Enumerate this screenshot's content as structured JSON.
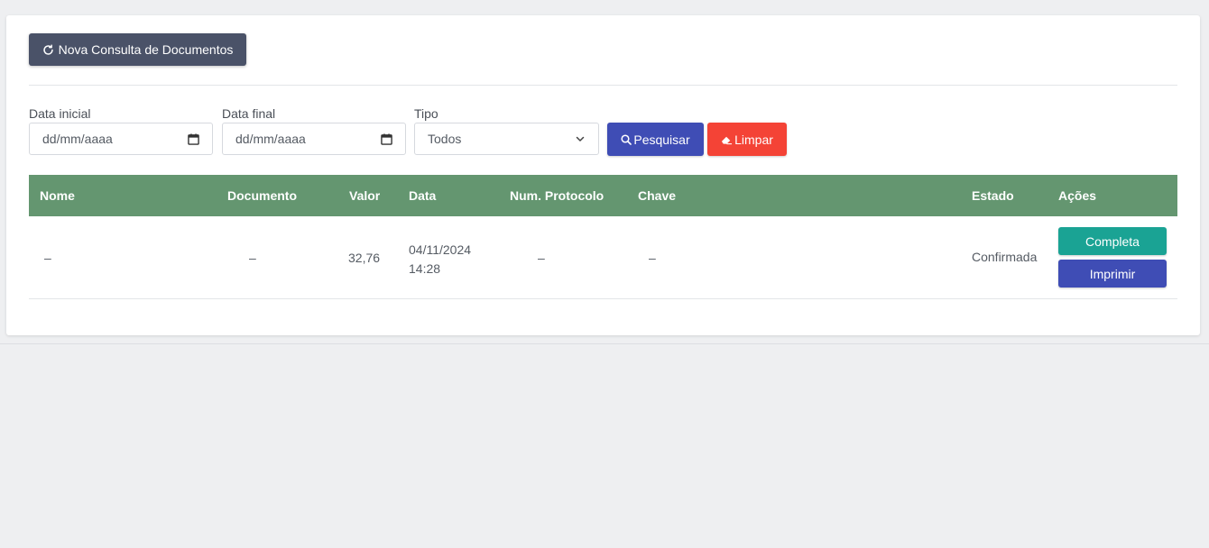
{
  "toolbar": {
    "new_query_label": "Nova Consulta de Documentos",
    "new_query_icon": "refresh-icon"
  },
  "filters": {
    "start_date": {
      "label": "Data inicial",
      "placeholder": "dd/mm/aaaa",
      "icon": "calendar-icon"
    },
    "end_date": {
      "label": "Data final",
      "placeholder": "dd/mm/aaaa",
      "icon": "calendar-icon"
    },
    "type": {
      "label": "Tipo",
      "selected": "Todos",
      "icon": "chevron-down-icon"
    },
    "search_label": "Pesquisar",
    "search_icon": "search-icon",
    "clear_label": "Limpar",
    "clear_icon": "eraser-icon"
  },
  "table": {
    "columns": [
      "Nome",
      "Documento",
      "Valor",
      "Data",
      "Num. Protocolo",
      "Chave",
      "Estado",
      "Ações"
    ],
    "rows": [
      {
        "nome": "–",
        "documento": "–",
        "valor": "32,76",
        "data_date": "04/11/2024",
        "data_time": "14:28",
        "protocolo": "–",
        "chave": "–",
        "estado": "Confirmada",
        "actions": [
          "Completa",
          "Imprimir"
        ]
      }
    ]
  },
  "colors": {
    "header_green": "#649670",
    "primary_dark": "#4a5268",
    "search_blue": "#3f4db5",
    "clear_red": "#f44336",
    "teal": "#1aa394"
  }
}
